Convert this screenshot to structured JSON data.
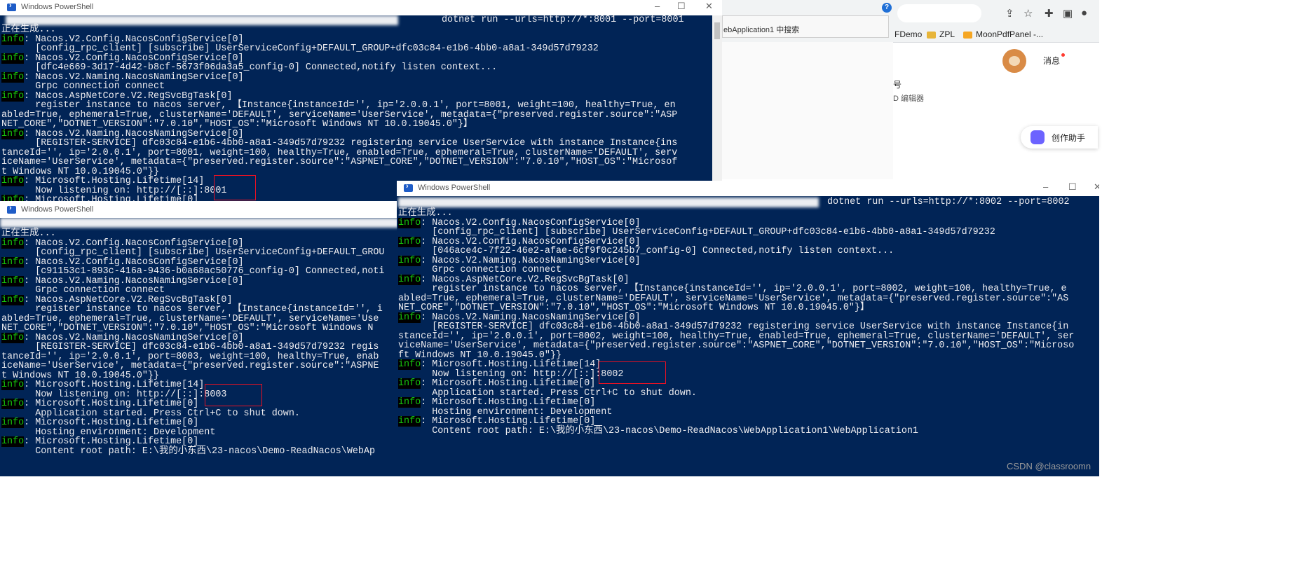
{
  "browser": {
    "search_text": "ebApplication1 中搜索",
    "bookmarks": [
      "FDemo",
      "ZPL",
      "MoonPdfPanel -..."
    ],
    "message_label": "消息",
    "side_title": "号",
    "side_sub": "D 编辑器",
    "writer_label": "创作助手"
  },
  "watermark": "CSDN @classroomn",
  "windows": [
    {
      "title": "Windows PowerShell",
      "command_line": "dotnet run --urls=http://*:8001 --port=8001",
      "lines": [
        {
          "t": "正在生成..."
        },
        {
          "info": true,
          "t": "Nacos.V2.Config.NacosConfigService[0]"
        },
        {
          "t": "      [config_rpc_client] [subscribe] UserServiceConfig+DEFAULT_GROUP+dfc03c84-e1b6-4bb0-a8a1-349d57d79232"
        },
        {
          "info": true,
          "t": "Nacos.V2.Config.NacosConfigService[0]"
        },
        {
          "t": "      [dfc4e669-3d17-4d42-b8cf-5673f06da3a5_config-0] Connected,notify listen context..."
        },
        {
          "info": true,
          "t": "Nacos.V2.Naming.NacosNamingService[0]"
        },
        {
          "t": "      Grpc connection connect"
        },
        {
          "info": true,
          "t": "Nacos.AspNetCore.V2.RegSvcBgTask[0]"
        },
        {
          "t": "      register instance to nacos server, 【Instance{instanceId='', ip='2.0.0.1', port=8001, weight=100, healthy=True, en"
        },
        {
          "t": "abled=True, ephemeral=True, clusterName='DEFAULT', serviceName='UserService', metadata={\"preserved.register.source\":\"ASP"
        },
        {
          "t": "NET_CORE\",\"DOTNET_VERSION\":\"7.0.10\",\"HOST_OS\":\"Microsoft Windows NT 10.0.19045.0\"}】"
        },
        {
          "info": true,
          "t": "Nacos.V2.Naming.NacosNamingService[0]"
        },
        {
          "t": "      [REGISTER-SERVICE] dfc03c84-e1b6-4bb0-a8a1-349d57d79232 registering service UserService with instance Instance{ins"
        },
        {
          "t": "tanceId='', ip='2.0.0.1', port=8001, weight=100, healthy=True, enabled=True, ephemeral=True, clusterName='DEFAULT', serv"
        },
        {
          "t": "iceName='UserService', metadata={\"preserved.register.source\":\"ASPNET_CORE\",\"DOTNET_VERSION\":\"7.0.10\",\"HOST_OS\":\"Microsof"
        },
        {
          "t": "t Windows NT 10.0.19045.0\"}}"
        },
        {
          "info": true,
          "t": "Microsoft.Hosting.Lifetime[14]"
        },
        {
          "t": "      Now listening on: http://[::]:8001"
        },
        {
          "info": true,
          "t": "Microsoft.Hosting.Lifetime[0]"
        }
      ]
    },
    {
      "title": "Windows PowerShell",
      "command_line": "",
      "lines": [
        {
          "t": "正在生成..."
        },
        {
          "info": true,
          "t": "Nacos.V2.Config.NacosConfigService[0]"
        },
        {
          "t": "      [config_rpc_client] [subscribe] UserServiceConfig+DEFAULT_GROU"
        },
        {
          "info": true,
          "t": "Nacos.V2.Config.NacosConfigService[0]"
        },
        {
          "t": "      [c91153c1-893c-416a-9436-b0a68ac50776_config-0] Connected,noti"
        },
        {
          "info": true,
          "t": "Nacos.V2.Naming.NacosNamingService[0]"
        },
        {
          "t": "      Grpc connection connect"
        },
        {
          "info": true,
          "t": "Nacos.AspNetCore.V2.RegSvcBgTask[0]"
        },
        {
          "t": "      register instance to nacos server, 【Instance{instanceId='', i"
        },
        {
          "t": "abled=True, ephemeral=True, clusterName='DEFAULT', serviceName='Use"
        },
        {
          "t": "NET_CORE\",\"DOTNET_VERSION\":\"7.0.10\",\"HOST_OS\":\"Microsoft Windows N"
        },
        {
          "info": true,
          "t": "Nacos.V2.Naming.NacosNamingService[0]"
        },
        {
          "t": "      [REGISTER-SERVICE] dfc03c84-e1b6-4bb0-a8a1-349d57d79232 regis"
        },
        {
          "t": "tanceId='', ip='2.0.0.1', port=8003, weight=100, healthy=True, enab"
        },
        {
          "t": "iceName='UserService', metadata={\"preserved.register.source\":\"ASPNE"
        },
        {
          "t": "t Windows NT 10.0.19045.0\"}}"
        },
        {
          "info": true,
          "t": "Microsoft.Hosting.Lifetime[14]"
        },
        {
          "t": "      Now listening on: http://[::]:8003"
        },
        {
          "info": true,
          "t": "Microsoft.Hosting.Lifetime[0]"
        },
        {
          "t": "      Application started. Press Ctrl+C to shut down."
        },
        {
          "info": true,
          "t": "Microsoft.Hosting.Lifetime[0]"
        },
        {
          "t": "      Hosting environment: Development"
        },
        {
          "info": true,
          "t": "Microsoft.Hosting.Lifetime[0]"
        },
        {
          "t": "      Content root path: E:\\我的小东西\\23-nacos\\Demo-ReadNacos\\WebAp"
        }
      ]
    },
    {
      "title": "Windows PowerShell",
      "command_line": "dotnet run --urls=http://*:8002 --port=8002",
      "lines": [
        {
          "t": "正在生成..."
        },
        {
          "info": true,
          "t": "Nacos.V2.Config.NacosConfigService[0]"
        },
        {
          "t": "      [config_rpc_client] [subscribe] UserServiceConfig+DEFAULT_GROUP+dfc03c84-e1b6-4bb0-a8a1-349d57d79232"
        },
        {
          "info": true,
          "t": "Nacos.V2.Config.NacosConfigService[0]"
        },
        {
          "t": "      [046ace4c-7f22-46e2-afae-6cf9f0c245b7_config-0] Connected,notify listen context..."
        },
        {
          "info": true,
          "t": "Nacos.V2.Naming.NacosNamingService[0]"
        },
        {
          "t": "      Grpc connection connect"
        },
        {
          "info": true,
          "t": "Nacos.AspNetCore.V2.RegSvcBgTask[0]"
        },
        {
          "t": "      register instance to nacos server, 【Instance{instanceId='', ip='2.0.0.1', port=8002, weight=100, healthy=True, e"
        },
        {
          "t": "abled=True, ephemeral=True, clusterName='DEFAULT', serviceName='UserService', metadata={\"preserved.register.source\":\"AS"
        },
        {
          "t": "NET_CORE\",\"DOTNET_VERSION\":\"7.0.10\",\"HOST_OS\":\"Microsoft Windows NT 10.0.19045.0\"}】"
        },
        {
          "info": true,
          "t": "Nacos.V2.Naming.NacosNamingService[0]"
        },
        {
          "t": "      [REGISTER-SERVICE] dfc03c84-e1b6-4bb0-a8a1-349d57d79232 registering service UserService with instance Instance{in"
        },
        {
          "t": "stanceId='', ip='2.0.0.1', port=8002, weight=100, healthy=True, enabled=True, ephemeral=True, clusterName='DEFAULT', ser"
        },
        {
          "t": "viceName='UserService', metadata={\"preserved.register.source\":\"ASPNET_CORE\",\"DOTNET_VERSION\":\"7.0.10\",\"HOST_OS\":\"Microso"
        },
        {
          "t": "ft Windows NT 10.0.19045.0\"}}"
        },
        {
          "info": true,
          "t": "Microsoft.Hosting.Lifetime[14]"
        },
        {
          "t": "      Now listening on: http://[::]:8002"
        },
        {
          "info": true,
          "t": "Microsoft.Hosting.Lifetime[0]"
        },
        {
          "t": "      Application started. Press Ctrl+C to shut down."
        },
        {
          "info": true,
          "t": "Microsoft.Hosting.Lifetime[0]"
        },
        {
          "t": "      Hosting environment: Development"
        },
        {
          "info": true,
          "t": "Microsoft.Hosting.Lifetime[0]"
        },
        {
          "t": "      Content root path: E:\\我的小东西\\23-nacos\\Demo-ReadNacos\\WebApplication1\\WebApplication1"
        }
      ]
    }
  ]
}
